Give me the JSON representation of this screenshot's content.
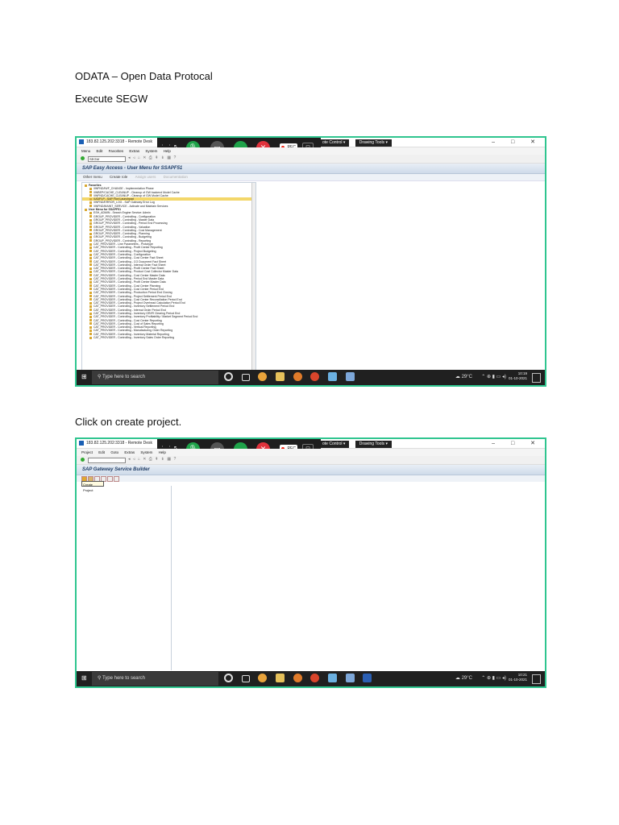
{
  "document": {
    "heading": "ODATA – Open Data Protocal",
    "step1": "Execute SEGW",
    "step2": "Click on create project."
  },
  "remote_window": {
    "title": "183.82.125.202:3318 - Remote Desk",
    "tabs": [
      "ote Control ▾",
      "Drawing Tools ▾"
    ],
    "window_controls": "– □ ✕"
  },
  "meeting_bar": {
    "rec_label": "REC",
    "icons": [
      "drag-icon",
      "collapse-icon",
      "mic-icon",
      "camera-off-icon",
      "share-screen-icon",
      "end-call-icon",
      "lock-icon"
    ]
  },
  "screenshot1": {
    "menu": [
      "Menu",
      "Edit",
      "Favorites",
      "Extras",
      "System",
      "Help"
    ],
    "command_value": "SEGW",
    "header": "SAP Easy Access  -  User Menu for SSAPF51",
    "app_toolbar": [
      "Other menu",
      "Create role",
      "Assign users",
      "Documentation"
    ],
    "tree_items": [
      {
        "text": "Favorites",
        "level": 0
      },
      {
        "text": "/IWFND/IWF_CHANGE - Implementation Phase",
        "level": 1
      },
      {
        "text": "/IWBEP/CACHE_CLEANUP - Cleanup of GW backend Model Cache",
        "level": 1
      },
      {
        "text": "/IWFND/CACHE_CLEANUP - Cleanup of GW Model Cache",
        "level": 1
      },
      {
        "text": "/UI2/FLP - SAP Fiori Launchpad",
        "level": 1,
        "highlight": true
      },
      {
        "text": "/IWFND/ERROR_LOG - SAP Gateway Error Log",
        "level": 1
      },
      {
        "text": "/IWFND/MAINT_SERVICE - Activate and Maintain Services",
        "level": 1
      },
      {
        "text": "User Menu for SSAPF51",
        "level": 0
      },
      {
        "text": "ESH_ADMIN - Search Engine Service: Admin",
        "level": 1
      },
      {
        "text": "GROUP_PROVIDER - Controlling - Configuration",
        "level": 1
      },
      {
        "text": "GROUP_PROVIDER - Controlling - Master Data",
        "level": 1
      },
      {
        "text": "GROUP_PROVIDER - Controlling - Period End Processing",
        "level": 1
      },
      {
        "text": "GROUP_PROVIDER - Controlling - Valuation",
        "level": 1
      },
      {
        "text": "GROUP_PROVIDER - Controlling - Cost Management",
        "level": 1
      },
      {
        "text": "GROUP_PROVIDER - Controlling - Planning",
        "level": 1
      },
      {
        "text": "GROUP_PROVIDER - Controlling - Budgeting",
        "level": 1
      },
      {
        "text": "GROUP_PROVIDER - Controlling - Reporting",
        "level": 1
      },
      {
        "text": "CAT_PROVIDER - Line Parameters - Prototype",
        "level": 1
      },
      {
        "text": "CAT_PROVIDER - Controlling - Profit Center Reporting",
        "level": 1
      },
      {
        "text": "CAT_PROVIDER - Controlling - Project Budgeting",
        "level": 1
      },
      {
        "text": "CAT_PROVIDER - Controlling - Configuration",
        "level": 1
      },
      {
        "text": "CAT_PROVIDER - Controlling - Cost Center Fact Sheet",
        "level": 1
      },
      {
        "text": "CAT_PROVIDER - Controlling - CO Document Fact Sheet",
        "level": 1
      },
      {
        "text": "CAT_PROVIDER - Controlling - Internal Order Fact Sheet",
        "level": 1
      },
      {
        "text": "CAT_PROVIDER - Controlling - Profit Center Fact Sheet",
        "level": 1
      },
      {
        "text": "CAT_PROVIDER - Controlling - Product Cost Collector Master Data",
        "level": 1
      },
      {
        "text": "CAT_PROVIDER - Controlling - Cost Center Master Data",
        "level": 1
      },
      {
        "text": "CAT_PROVIDER - Controlling - Period End Master Data",
        "level": 1
      },
      {
        "text": "CAT_PROVIDER - Controlling - Profit Center Master Data",
        "level": 1
      },
      {
        "text": "CAT_PROVIDER - Controlling - Cost Center Planning",
        "level": 1
      },
      {
        "text": "CAT_PROVIDER - Controlling - Cost Center Period End",
        "level": 1
      },
      {
        "text": "CAT_PROVIDER - Controlling - Production Period End Closing",
        "level": 1
      },
      {
        "text": "CAT_PROVIDER - Controlling - Project Settlement Period End",
        "level": 1
      },
      {
        "text": "CAT_PROVIDER - Controlling - Cost Center Reconciliation Period End",
        "level": 1
      },
      {
        "text": "CAT_PROVIDER - Controlling - Project Overhead Calculation Period End",
        "level": 1
      },
      {
        "text": "CAT_PROVIDER - Controlling - Inventory Settlement Period End",
        "level": 1
      },
      {
        "text": "CAT_PROVIDER - Controlling - Internal Order Period End",
        "level": 1
      },
      {
        "text": "CAT_PROVIDER - Controlling - Inventory GR/IR Clearing Period End",
        "level": 1
      },
      {
        "text": "CAT_PROVIDER - Controlling - Inventory Profitability / Market Segment Period End",
        "level": 1
      },
      {
        "text": "CAT_PROVIDER - Controlling - Cost Center Reporting",
        "level": 1
      },
      {
        "text": "CAT_PROVIDER - Controlling - Cost of Sales Reporting",
        "level": 1
      },
      {
        "text": "CAT_PROVIDER - Controlling - Vertical Reporting",
        "level": 1
      },
      {
        "text": "CAT_PROVIDER - Controlling - Manufacturing Order Reporting",
        "level": 1
      },
      {
        "text": "CAT_PROVIDER - Controlling - Inventory Material Reporting",
        "level": 1
      },
      {
        "text": "CAT_PROVIDER - Controlling - Inventory Sales Order Reporting",
        "level": 1
      }
    ],
    "taskbar": {
      "search_placeholder": "Type here to search",
      "temperature": "29°C",
      "time": "10:19",
      "date": "01-10-2021"
    }
  },
  "screenshot2": {
    "menu": [
      "Project",
      "Edit",
      "Goto",
      "Extras",
      "System",
      "Help"
    ],
    "header": "SAP Gateway Service Builder",
    "tooltip": "Create Project",
    "taskbar": {
      "search_placeholder": "Type here to search",
      "temperature": "29°C",
      "time": "10:21",
      "date": "01-10-2021"
    }
  },
  "colors": {
    "frame_border": "#2fc58f",
    "sap_header_text": "#1f3d66",
    "taskbar_bg": "#202020",
    "meeting_bar_bg": "#1e1e1e",
    "mic_green": "#1fa34a",
    "end_call_red": "#e0323c"
  }
}
